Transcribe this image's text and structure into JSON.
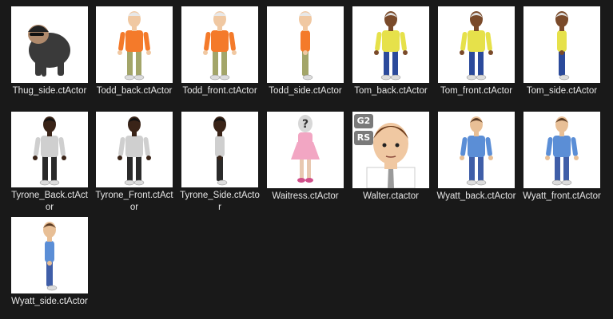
{
  "files": [
    {
      "name": "Thug_side.ctActor",
      "icon": "thug-figure",
      "colors": {
        "shirt": "#3a3a3a",
        "pants": "#3a3a3a",
        "skin": "#b08a6c"
      }
    },
    {
      "name": "Todd_back.ctActor",
      "icon": "todd-figure",
      "colors": {
        "shirt": "#f47a2a",
        "pants": "#a3a569",
        "skin": "#f0c8a2"
      }
    },
    {
      "name": "Todd_front.ctActor",
      "icon": "todd-figure",
      "colors": {
        "shirt": "#f47a2a",
        "pants": "#a3a569",
        "skin": "#f0c8a2"
      }
    },
    {
      "name": "Todd_side.ctActor",
      "icon": "todd-figure",
      "colors": {
        "shirt": "#f47a2a",
        "pants": "#a3a569",
        "skin": "#f0c8a2"
      }
    },
    {
      "name": "Tom_back.ctActor",
      "icon": "tom-figure",
      "colors": {
        "shirt": "#e6e14a",
        "pants": "#2b4a9b",
        "skin": "#7a4a2a"
      }
    },
    {
      "name": "Tom_front.ctActor",
      "icon": "tom-figure",
      "colors": {
        "shirt": "#e6e14a",
        "pants": "#2b4a9b",
        "skin": "#7a4a2a"
      }
    },
    {
      "name": "Tom_side.ctActor",
      "icon": "tom-figure",
      "colors": {
        "shirt": "#e6e14a",
        "pants": "#2b4a9b",
        "skin": "#7a4a2a"
      }
    },
    {
      "name": "Tyrone_Back.ctActor",
      "icon": "tyrone-figure",
      "colors": {
        "shirt": "#cfcfcf",
        "pants": "#2a2a2a",
        "skin": "#3a2418"
      }
    },
    {
      "name": "Tyrone_Front.ctActor",
      "icon": "tyrone-figure",
      "colors": {
        "shirt": "#cfcfcf",
        "pants": "#2a2a2a",
        "skin": "#3a2418"
      }
    },
    {
      "name": "Tyrone_Side.ctActor",
      "icon": "tyrone-figure",
      "colors": {
        "shirt": "#cfcfcf",
        "pants": "#2a2a2a",
        "skin": "#3a2418"
      }
    },
    {
      "name": "Waitress.ctActor",
      "icon": "waitress-figure",
      "colors": {
        "shirt": "#f2a6c3",
        "pants": "#f2a6c3",
        "skin": "#d8d8d8"
      }
    },
    {
      "name": "Walter.ctactor",
      "icon": "walter-portrait",
      "badges": [
        "G2",
        "RS"
      ],
      "colors": {
        "shirt": "#ffffff",
        "pants": "#ffffff",
        "skin": "#f0c8a2"
      }
    },
    {
      "name": "Wyatt_back.ctActor",
      "icon": "wyatt-figure",
      "colors": {
        "shirt": "#5b8ed6",
        "pants": "#3f5ea8",
        "skin": "#e8bf96"
      }
    },
    {
      "name": "Wyatt_front.ctActor",
      "icon": "wyatt-figure",
      "colors": {
        "shirt": "#5b8ed6",
        "pants": "#3f5ea8",
        "skin": "#e8bf96"
      }
    },
    {
      "name": "Wyatt_side.ctActor",
      "icon": "wyatt-figure",
      "colors": {
        "shirt": "#5b8ed6",
        "pants": "#3f5ea8",
        "skin": "#e8bf96"
      }
    }
  ]
}
